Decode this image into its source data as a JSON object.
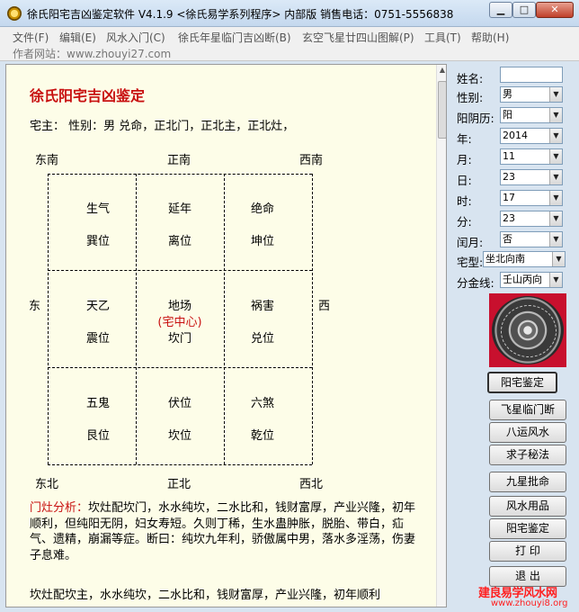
{
  "window": {
    "title": "徐氏阳宅吉凶鉴定软件 V4.1.9  <徐氏易学系列程序> 内部版   销售电话：0751-5556838",
    "minimize_label": "▁",
    "maximize_label": "□",
    "close_label": "✕"
  },
  "menu": [
    "文件(F)",
    "编辑(E)",
    "风水入门(C)",
    "徐氏年星临门吉凶断(B)",
    "玄空飞星廿四山图解(P)",
    "工具(T)",
    "帮助(H)"
  ],
  "author_site": "作者网站：www.zhouyi27.com",
  "main": {
    "title": "徐氏阳宅吉凶鉴定",
    "owner_line": "宅主：  性别：男   兑命，正北门，正北主，正北灶，",
    "directions": {
      "se": "东南",
      "s": "正南",
      "sw": "西南",
      "e": "东",
      "w": "西",
      "ne": "东北",
      "n": "正北",
      "nw": "西北"
    },
    "grid": [
      {
        "star": "生气",
        "pos": "巽位"
      },
      {
        "star": "延年",
        "pos": "离位"
      },
      {
        "star": "绝命",
        "pos": "坤位"
      },
      {
        "star": "天乙",
        "pos": "震位"
      },
      {
        "star": "地场",
        "center": "(宅中心)",
        "pos": "坎门"
      },
      {
        "star": "祸害",
        "pos": "兑位"
      },
      {
        "star": "五鬼",
        "pos": "艮位"
      },
      {
        "star": "伏位",
        "pos": "坎位"
      },
      {
        "star": "六煞",
        "pos": "乾位"
      }
    ],
    "analysis_label": "门灶分析：",
    "analysis_text": "坎灶配坎门，水水纯坎，二水比和，钱财富厚，产业兴隆，初年顺利，但纯阳无阴，妇女寿短。久则丁稀，生水蛊肿胀，脱胎、带白，疝气、遗精，崩漏等症。断曰：纯坎九年利，骄傲属中男，落水多淫荡，伤妻子息难。",
    "analysis_cut": "坎灶配坎主，水水纯坎，二水比和，钱财富厚，产业兴隆，初年顺利"
  },
  "form": {
    "name_label": "姓名:",
    "name_value": "",
    "gender_label": "性别:",
    "gender_value": "男",
    "calendar_label": "阳阴历:",
    "calendar_value": "阳",
    "year_label": "年:",
    "year_value": "2014",
    "month_label": "月:",
    "month_value": "11",
    "day_label": "日:",
    "day_value": "23",
    "hour_label": "时:",
    "hour_value": "17",
    "minute_label": "分:",
    "minute_value": "23",
    "leap_label": "闰月:",
    "leap_value": "否",
    "house_label": "宅型:",
    "house_value": "坐北向南",
    "line_label": "分金线:",
    "line_value": "壬山丙向"
  },
  "buttons": {
    "yangzhai_main": "阳宅鉴定",
    "feixing": "飞星临门断",
    "bayun": "八运风水",
    "qiuzi": "求子秘法",
    "jiuxing": "九星批命",
    "fengshui_goods": "风水用品",
    "yangzhai_2": "阳宅鉴定",
    "print": "打  印",
    "exit": "退  出"
  },
  "watermark": {
    "line1": "建良易学风水网",
    "line2": "www.zhouyi8.org"
  }
}
